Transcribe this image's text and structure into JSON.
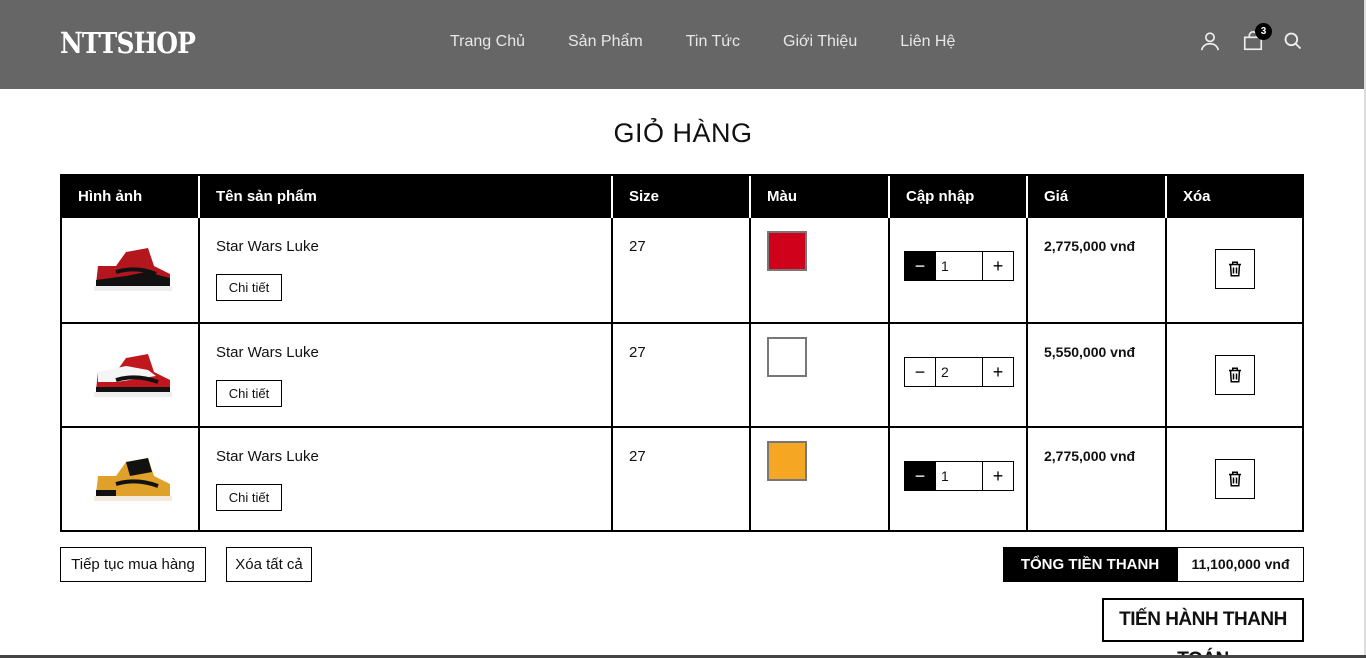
{
  "header": {
    "logo": "NTTSHOP",
    "nav": [
      "Trang Chủ",
      "Sản Phẩm",
      "Tin Tức",
      "Giới Thiệu",
      "Liên Hệ"
    ],
    "cart_count": "3",
    "icons": [
      "user-icon",
      "shopping-bag-icon",
      "search-icon"
    ]
  },
  "page_title": "GIỎ HÀNG",
  "table": {
    "headers": [
      "Hình ảnh",
      "Tên sản phẩm",
      "Size",
      "Màu",
      "Cập nhập",
      "Giá",
      "Xóa"
    ],
    "rows": [
      {
        "name": "Star Wars Luke",
        "detail_label": "Chi tiết",
        "size": "27",
        "color": "#d0021b",
        "quantity": "1",
        "price": "2,775,000 vnđ",
        "shoe_colors": [
          "#b3161c",
          "#111111"
        ]
      },
      {
        "name": "Star Wars Luke",
        "detail_label": "Chi tiết",
        "size": "27",
        "color": "#ffffff",
        "quantity": "2",
        "price": "5,550,000 vnđ",
        "shoe_colors": [
          "#c0171f",
          "#f5f5f5"
        ]
      },
      {
        "name": "Star Wars Luke",
        "detail_label": "Chi tiết",
        "size": "27",
        "color": "#f5a623",
        "quantity": "1",
        "price": "2,775,000 vnđ",
        "shoe_colors": [
          "#e0a12a",
          "#111111"
        ]
      }
    ]
  },
  "actions": {
    "continue_label": "Tiếp tục mua hàng",
    "clear_label": "Xóa tất cả",
    "total_label": "TỔNG TIỀN THANH TOÁN",
    "total_value": "11,100,000 vnđ",
    "checkout_label": "TIẾN HÀNH THANH TOÁN"
  }
}
